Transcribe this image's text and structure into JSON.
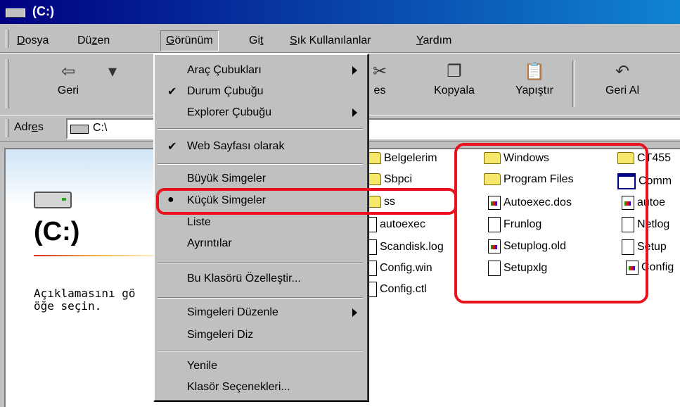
{
  "window": {
    "title": "(C:)"
  },
  "menubar": {
    "items": [
      {
        "label": "Dosya",
        "u": "D",
        "rest": "osya"
      },
      {
        "label": "Düzen",
        "pre": "Dü",
        "u": "z",
        "rest": "en"
      },
      {
        "label": "Görünüm",
        "u": "G",
        "rest": "örünüm"
      },
      {
        "label": "Git",
        "pre": "Gi",
        "u": "t",
        "rest": ""
      },
      {
        "label": "Sık Kullanılanlar",
        "u": "S",
        "rest": "ık Kullanılanlar"
      },
      {
        "label": "Yardım",
        "u": "Y",
        "rest": "ardım"
      }
    ]
  },
  "toolbar": {
    "back": "Geri",
    "cut_partial": "es",
    "copy": "Kopyala",
    "paste": "Yapıştır",
    "undo": "Geri Al"
  },
  "address": {
    "label_pre": "Adr",
    "label_u": "e",
    "label_post": "s",
    "value": "C:\\"
  },
  "leftpanel": {
    "title": "(C:)",
    "desc_line1": "Açıklamasını gö",
    "desc_line2": "öğe seçin."
  },
  "files": [
    {
      "name": "Belgelerim",
      "icon": "folder"
    },
    {
      "name": "Sbpci",
      "icon": "folder"
    },
    {
      "name": "ss",
      "icon": "folder"
    },
    {
      "name": "autoexec",
      "icon": "doc"
    },
    {
      "name": "Scandisk.log",
      "icon": "doc"
    },
    {
      "name": "Config.win",
      "icon": "doc"
    },
    {
      "name": "Config.ctl",
      "icon": "doc"
    },
    {
      "name": "Windows",
      "icon": "folder"
    },
    {
      "name": "Program Files",
      "icon": "folder"
    },
    {
      "name": "Autoexec.dos",
      "icon": "sys"
    },
    {
      "name": "Frunlog",
      "icon": "doc"
    },
    {
      "name": "Setuplog.old",
      "icon": "sys"
    },
    {
      "name": "Setupxlg",
      "icon": "doc"
    },
    {
      "name": "CT455",
      "icon": "folder"
    },
    {
      "name": "Comm",
      "icon": "win"
    },
    {
      "name": "autoe",
      "icon": "sys"
    },
    {
      "name": "Netlog",
      "icon": "doc"
    },
    {
      "name": "Setup",
      "icon": "doc"
    },
    {
      "name": "Config",
      "icon": "sys"
    }
  ],
  "view_menu": {
    "items": [
      {
        "label": "Araç Çubukları",
        "submenu": true
      },
      {
        "label": "Durum Çubuğu",
        "checked": true
      },
      {
        "label": "Explorer Çubuğu",
        "submenu": true
      },
      {
        "label": "Web Sayfası olarak",
        "checked": true
      },
      {
        "label": "Büyük Simgeler"
      },
      {
        "label": "Küçük Simgeler",
        "radio": true
      },
      {
        "label": "Liste"
      },
      {
        "label": "Ayrıntılar"
      },
      {
        "label": "Bu Klasörü Özelleştir..."
      },
      {
        "label": "Simgeleri Düzenle",
        "submenu": true
      },
      {
        "label": "Simgeleri Diz"
      },
      {
        "label": "Yenile"
      },
      {
        "label": "Klasör Seçenekleri..."
      }
    ]
  },
  "icons": {
    "check": "checkmark-icon",
    "radio": "radio-dot-icon",
    "submenu": "submenu-arrow-icon"
  },
  "colors": {
    "title_gradient_start": "#000080",
    "title_gradient_end": "#1084d0",
    "highlight": "#e8121c",
    "chrome": "#c0c0c0"
  }
}
